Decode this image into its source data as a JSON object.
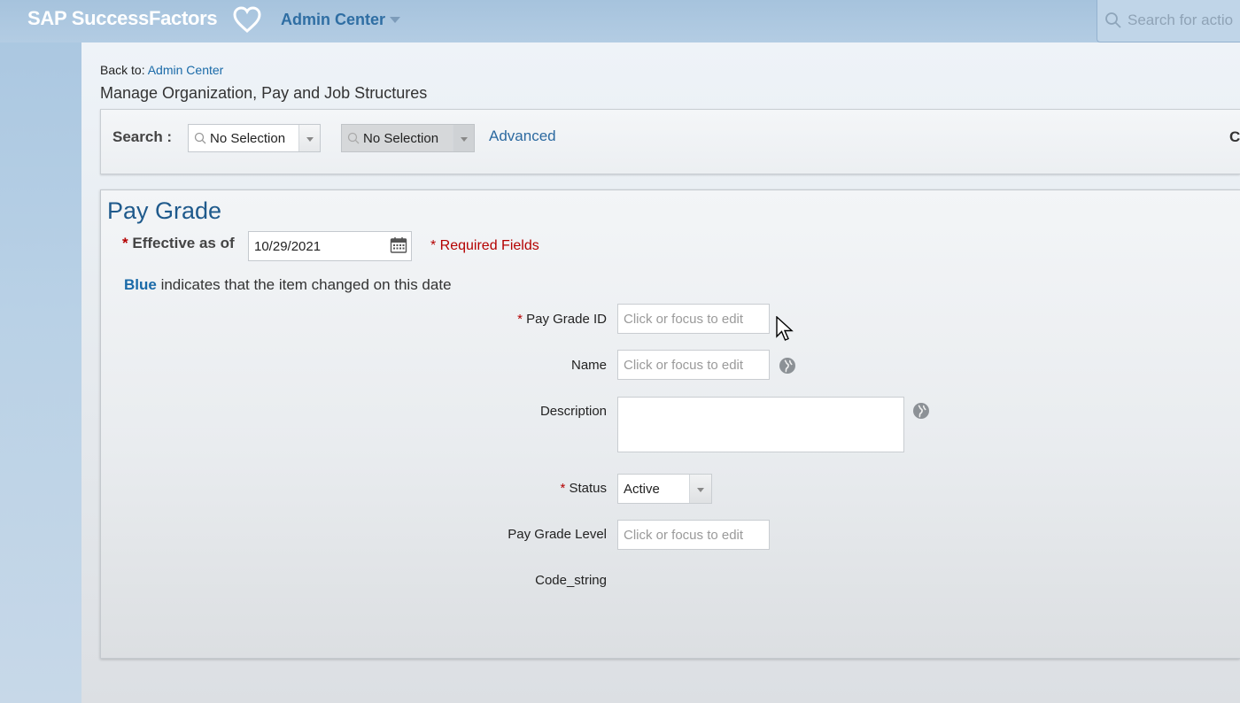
{
  "header": {
    "logo_text": "SAP SuccessFactors",
    "logo_icon": "heart-icon",
    "nav_label": "Admin Center",
    "search_placeholder": "Search for actio"
  },
  "breadcrumb": {
    "prefix": "Back to:",
    "link_label": "Admin Center"
  },
  "page_title": "Manage Organization, Pay and Job Structures",
  "search_bar": {
    "label": "Search :",
    "first_select_value": "No Selection",
    "second_select_value": "No Selection",
    "advanced_label": "Advanced",
    "cut_off_text": "Cr"
  },
  "form": {
    "title": "Pay Grade",
    "effective_label": "Effective as of",
    "effective_value": "10/29/2021",
    "required_note": "* Required Fields",
    "legend_keyword": "Blue",
    "legend_text": "indicates that the item changed on this date",
    "fields": {
      "pay_grade_id": {
        "label": "Pay Grade ID",
        "placeholder": "Click or focus to edit",
        "required": true
      },
      "name": {
        "label": "Name",
        "placeholder": "Click or focus to edit",
        "required": false
      },
      "description": {
        "label": "Description",
        "required": false
      },
      "status": {
        "label": "Status",
        "value": "Active",
        "required": true
      },
      "pay_grade_level": {
        "label": "Pay Grade Level",
        "placeholder": "Click or focus to edit",
        "required": false
      },
      "code_string": {
        "label": "Code_string"
      }
    }
  },
  "colors": {
    "accent_blue": "#1a6aa8",
    "title_blue": "#1f5a8c",
    "required_red": "#b40000"
  }
}
